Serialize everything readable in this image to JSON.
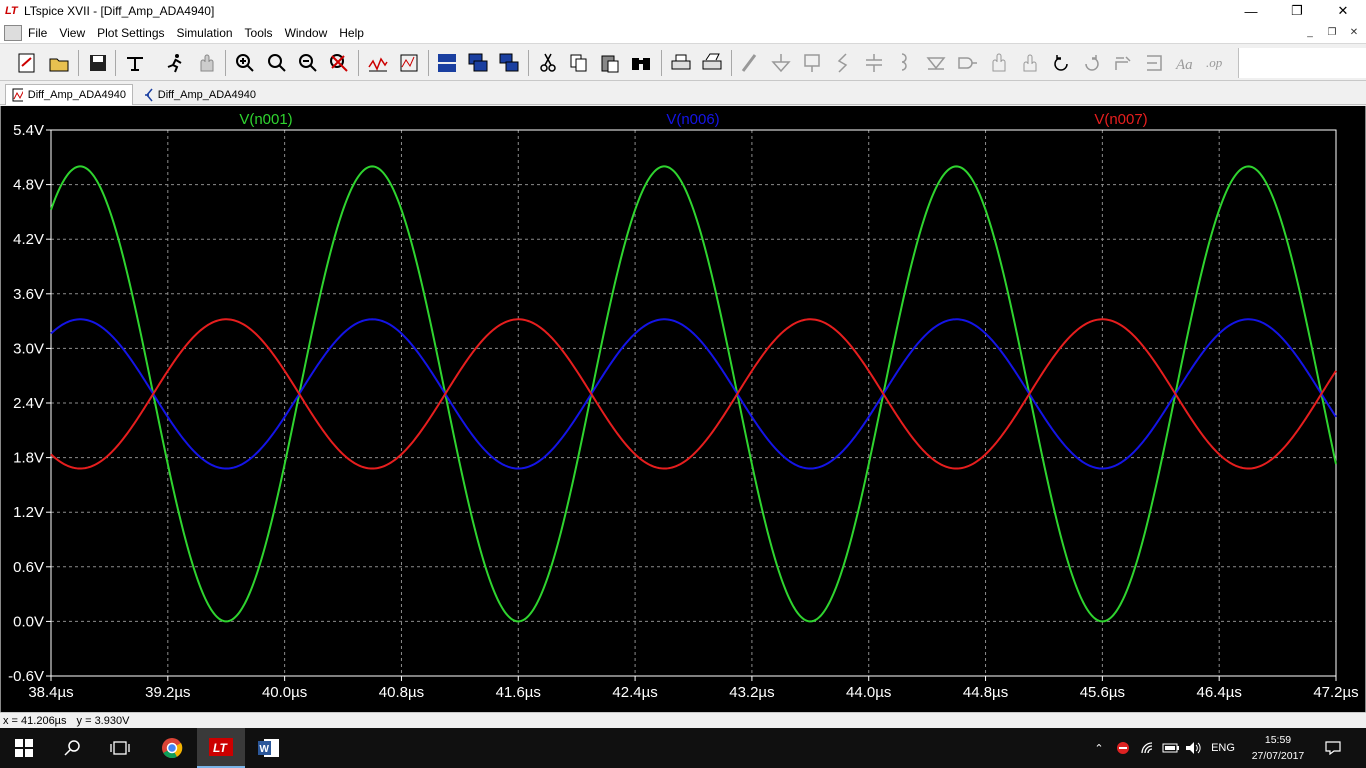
{
  "window": {
    "title": "LTspice XVII - [Diff_Amp_ADA4940]",
    "logo_text": "LT",
    "minimize": "—",
    "maximize": "❐",
    "close": "✕"
  },
  "menu": {
    "items": [
      "File",
      "View",
      "Plot Settings",
      "Simulation",
      "Tools",
      "Window",
      "Help"
    ],
    "mdi_minimize": "_",
    "mdi_restore": "❐",
    "mdi_close": "✕"
  },
  "toolbar": {
    "icons": [
      "new-schematic-icon",
      "open-icon",
      "save-icon",
      "control-panel-icon",
      "run-icon",
      "halt-icon",
      "zoom-in-icon",
      "zoom-area-icon",
      "zoom-out-icon",
      "zoom-cancel-icon",
      "autorange-icon",
      "add-traces-icon",
      "tile-horizontal-icon",
      "tile-vertical-icon",
      "cascade-icon",
      "cut-icon",
      "copy-icon",
      "paste-icon",
      "find-icon",
      "print-icon",
      "print-setup-icon",
      "draw-wire-icon",
      "ground-icon",
      "label-net-icon",
      "resistor-icon",
      "capacitor-icon",
      "inductor-icon",
      "diode-icon",
      "component-icon",
      "move-icon",
      "drag-icon",
      "undo-icon",
      "redo-icon",
      "rotate-icon",
      "mirror-icon",
      "text-icon",
      "spice-directive-icon"
    ]
  },
  "tabs": [
    {
      "label": "Diff_Amp_ADA4940",
      "active": true
    },
    {
      "label": "Diff_Amp_ADA4940",
      "active": false
    }
  ],
  "statusbar": {
    "x_readout": "x = 41.206µs",
    "y_readout": "y = 3.930V"
  },
  "taskbar": {
    "lang": "ENG",
    "time": "15:59",
    "date": "27/07/2017"
  },
  "chart_data": {
    "type": "line",
    "xlim": [
      38.4,
      47.2
    ],
    "ylim": [
      -0.6,
      5.4
    ],
    "xunit": "µs",
    "yunit": "V",
    "x_ticks": [
      "38.4µs",
      "39.2µs",
      "40.0µs",
      "40.8µs",
      "41.6µs",
      "42.4µs",
      "43.2µs",
      "44.0µs",
      "44.8µs",
      "45.6µs",
      "46.4µs",
      "47.2µs"
    ],
    "y_ticks": [
      "5.4V",
      "4.8V",
      "4.2V",
      "3.6V",
      "3.0V",
      "2.4V",
      "1.8V",
      "1.2V",
      "0.6V",
      "0.0V",
      "-0.6V"
    ],
    "grid": true,
    "background": "#000000",
    "axis_color": "#ffffff",
    "grid_color": "#8c8c8c",
    "series": [
      {
        "name": "V(n001)",
        "color": "#2fd42f",
        "offset": 2.5,
        "amplitude": 2.5,
        "period": 2.0,
        "phase_ref": 38.6,
        "shape": "cosine"
      },
      {
        "name": "V(n006)",
        "color": "#1414e6",
        "offset": 2.5,
        "amplitude": 0.82,
        "period": 2.0,
        "phase_ref": 38.6,
        "shape": "cosine"
      },
      {
        "name": "V(n007)",
        "color": "#e61e1e",
        "offset": 2.5,
        "amplitude": 0.82,
        "period": 2.0,
        "phase_ref": 38.6,
        "shape": "negcosine"
      }
    ]
  },
  "colors": {
    "title_bg": "#ffffff",
    "toolbar_bg": "#f0f0f0",
    "taskbar_bg": "#101010",
    "taskbar_active_underline": "#7ab4e8",
    "ltspice_red": "#cc0000"
  }
}
